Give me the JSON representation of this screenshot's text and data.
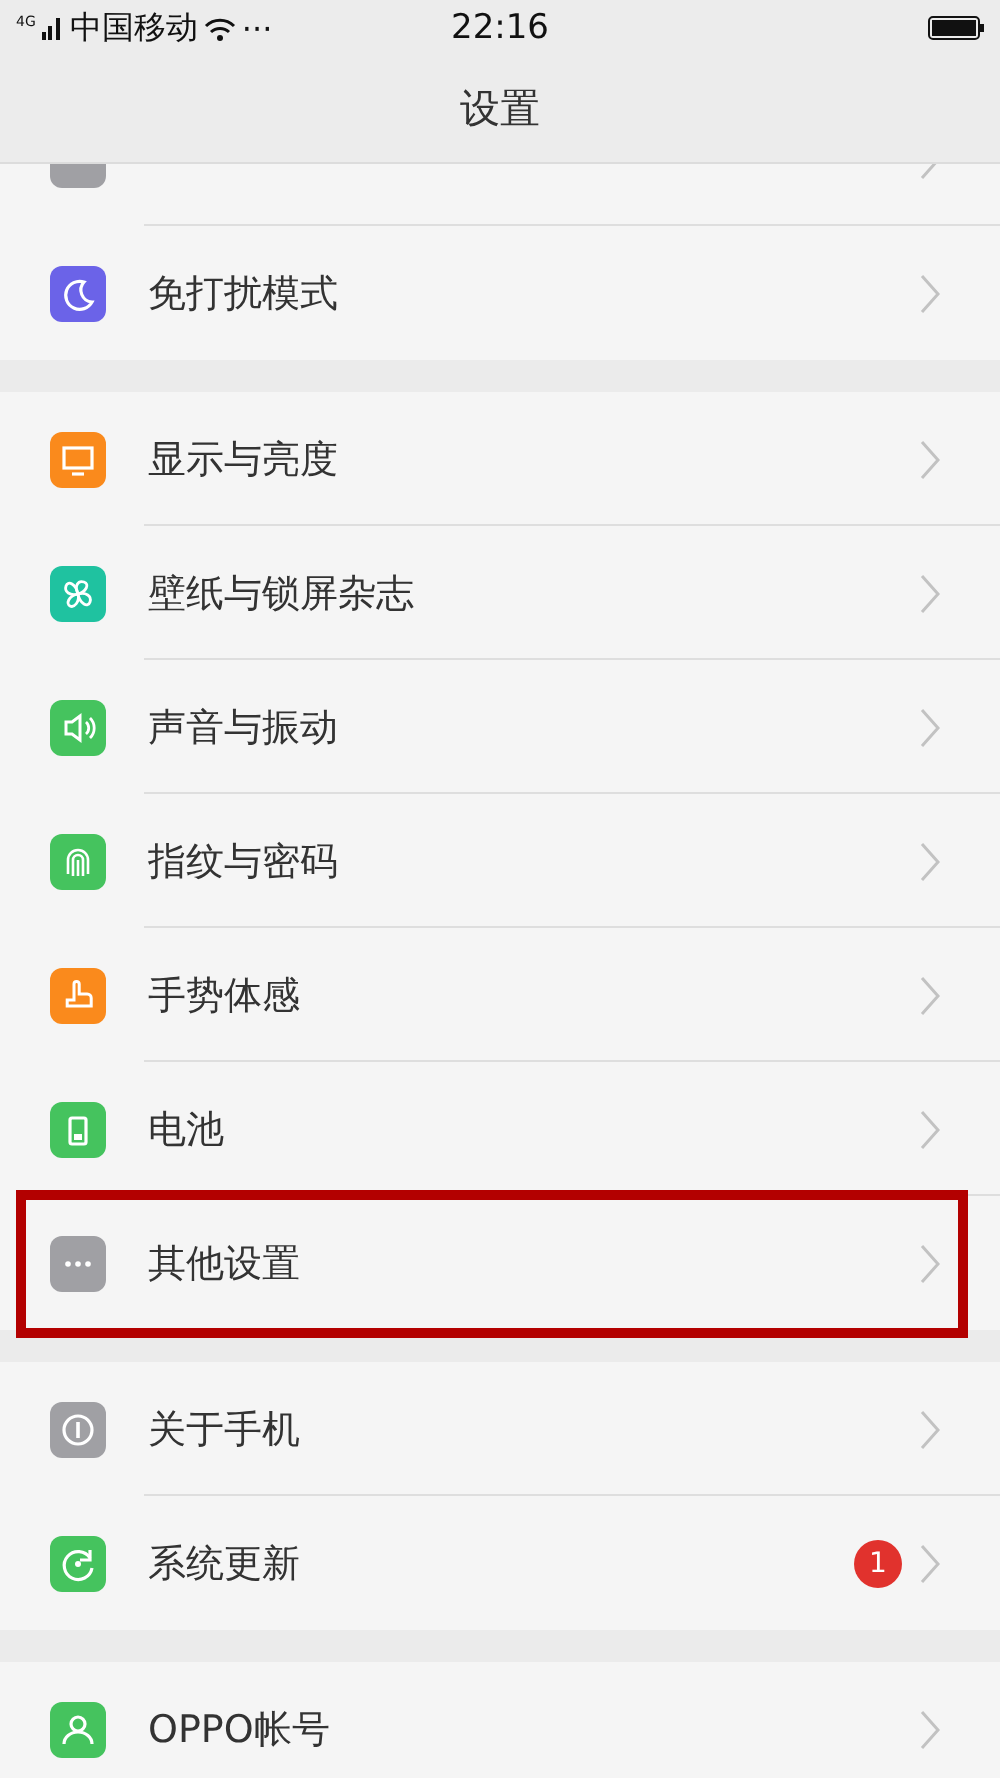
{
  "status_bar": {
    "network": "4G",
    "carrier": "中国移动",
    "more": "···",
    "time": "22:16"
  },
  "title": "设置",
  "groups": [
    {
      "items": [
        {
          "kind": "generic",
          "color": "#a0a0a4",
          "cut": true
        },
        {
          "label": "免打扰模式",
          "kind": "moon",
          "color": "#6b63e8"
        }
      ]
    },
    {
      "items": [
        {
          "label": "显示与亮度",
          "kind": "monitor",
          "color": "#fa8a1c"
        },
        {
          "label": "壁纸与锁屏杂志",
          "kind": "pinwheel",
          "color": "#1fc2a0"
        },
        {
          "label": "声音与振动",
          "kind": "speaker",
          "color": "#45c35e"
        },
        {
          "label": "指纹与密码",
          "kind": "fingerprint",
          "color": "#45c35e"
        },
        {
          "label": "手势体感",
          "kind": "hand",
          "color": "#fa8a1c"
        },
        {
          "label": "电池",
          "kind": "battery",
          "color": "#45c35e"
        },
        {
          "label": "其他设置",
          "kind": "dots",
          "color": "#a0a0a4",
          "highlighted": true
        }
      ]
    },
    {
      "items": [
        {
          "label": "关于手机",
          "kind": "info",
          "color": "#a0a0a4"
        },
        {
          "label": "系统更新",
          "kind": "refresh",
          "color": "#45c35e",
          "badge": "1"
        }
      ]
    },
    {
      "items": [
        {
          "label": "OPPO帐号",
          "kind": "person",
          "color": "#45c35e"
        }
      ]
    }
  ]
}
